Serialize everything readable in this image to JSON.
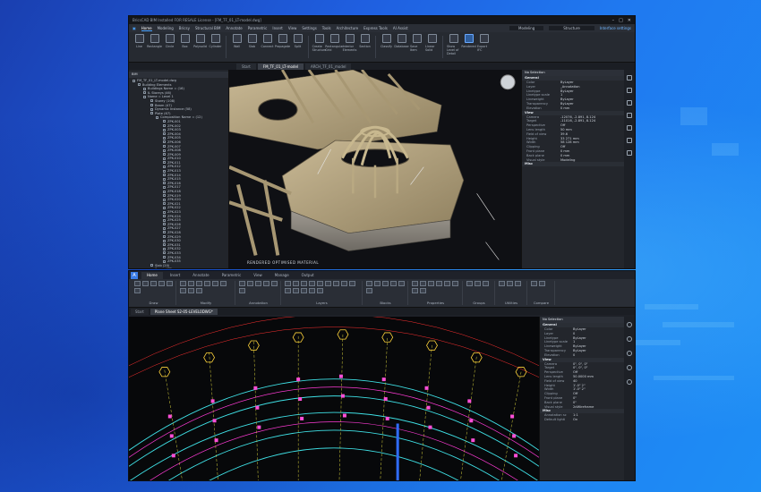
{
  "bricscad": {
    "title": "BricsCAD BIM Installed FOR RESALE License - [FM_TF_01_LT-model.dwg]",
    "menus": [
      {
        "label": "Home",
        "active": true
      },
      {
        "label": "Modeling",
        "active": false
      },
      {
        "label": "Bricsy",
        "active": false
      },
      {
        "label": "Structural BIM",
        "active": false
      },
      {
        "label": "Annotate",
        "active": false
      },
      {
        "label": "Parametric",
        "active": false
      },
      {
        "label": "Insert",
        "active": false
      },
      {
        "label": "View",
        "active": false
      },
      {
        "label": "Settings",
        "active": false
      },
      {
        "label": "Tools",
        "active": false
      },
      {
        "label": "Architecture",
        "active": false
      },
      {
        "label": "Express Tools",
        "active": false
      },
      {
        "label": "AI Assist",
        "active": false
      }
    ],
    "workspace": "Modeling",
    "layer_value": "Structure",
    "interface_settings": "Interface settings",
    "ribbon_buttons": [
      {
        "label": "Line",
        "hl": false
      },
      {
        "label": "Rectangle",
        "hl": false
      },
      {
        "label": "Circle",
        "hl": false
      },
      {
        "label": "Box",
        "hl": false
      },
      {
        "label": "Polysolid",
        "hl": false
      },
      {
        "label": "Cylinder",
        "hl": false
      },
      {
        "label": "Wall",
        "hl": false
      },
      {
        "label": "Slab",
        "hl": false
      },
      {
        "label": "Connect",
        "hl": false
      },
      {
        "label": "Propagate",
        "hl": false
      },
      {
        "label": "Split",
        "hl": false
      },
      {
        "label": "Create Structure",
        "hl": false
      },
      {
        "label": "Rectangular Grid",
        "hl": false
      },
      {
        "label": "Interior Elements",
        "hl": false
      },
      {
        "label": "Section",
        "hl": false
      },
      {
        "label": "Classify",
        "hl": false
      },
      {
        "label": "Database",
        "hl": false
      },
      {
        "label": "Save Item",
        "hl": false
      },
      {
        "label": "Linear Solid",
        "hl": false
      },
      {
        "label": "Show Level of Detail",
        "hl": false
      },
      {
        "label": "Rendered",
        "hl": true
      },
      {
        "label": "Export IFC",
        "hl": false
      }
    ],
    "doc_tabs": [
      {
        "label": "Start",
        "active": false
      },
      {
        "label": "FM_TF_01_LT-model",
        "active": true
      },
      {
        "label": "ARCH_TF_01_model",
        "active": false
      }
    ],
    "tree_header": "BIM",
    "tree_items": [
      "FM_TF_01_LT-model.dwg",
      "Building Elements",
      "Buildings Name = (16)",
      "IL Storeys (46)",
      "Name = Level 1",
      "Storey (108)",
      "Beam (47)",
      "Dynamic Instance (58)",
      "Plate (67)",
      "Composition Name = (12)",
      "ZPK-001",
      "ZPK-002",
      "ZPK-003",
      "ZPK-004",
      "ZPK-005",
      "ZPK-006",
      "ZPK-007",
      "ZPK-008",
      "ZPK-009",
      "ZPK-010",
      "ZPK-011",
      "ZPK-012",
      "ZPK-013",
      "ZPK-014",
      "ZPK-015",
      "ZPK-016",
      "ZPK-017",
      "ZPK-018",
      "ZPK-019",
      "ZPK-020",
      "ZPK-021",
      "ZPK-022",
      "ZPK-023",
      "ZPK-024",
      "ZPK-025",
      "ZPK-026",
      "ZPK-027",
      "ZPK-028",
      "ZPK-029",
      "ZPK-030",
      "ZPK-031",
      "ZPK-032",
      "ZPK-033",
      "ZPK-034",
      "ZPK-035",
      "Slab (20)",
      "Space (77)",
      "Wall (18)"
    ],
    "viewport_caption": "RENDERED OPTIMISED MATERIAL",
    "props_header": "No Selection",
    "props_sections": [
      {
        "name": "General",
        "rows": [
          {
            "k": "Color",
            "v": "ByLayer"
          },
          {
            "k": "Layer",
            "v": "_Annotation"
          },
          {
            "k": "Linetype",
            "v": "ByLayer"
          },
          {
            "k": "Linetype scale",
            "v": "1"
          },
          {
            "k": "Lineweight",
            "v": "ByLayer"
          },
          {
            "k": "Transparency",
            "v": "ByLayer"
          },
          {
            "k": "Elevation",
            "v": "0 mm"
          }
        ]
      },
      {
        "name": "View",
        "rows": [
          {
            "k": "Camera",
            "v": "-12076, -2.891, 8.124"
          },
          {
            "k": "Target",
            "v": "-11016, -2.891, 8.124"
          },
          {
            "k": "Perspective",
            "v": "Off"
          },
          {
            "k": "Lens length",
            "v": "50 mm"
          },
          {
            "k": "Field of view",
            "v": "39.6"
          },
          {
            "k": "Height",
            "v": "33 271 mm"
          },
          {
            "k": "Width",
            "v": "58 128 mm"
          },
          {
            "k": "Clipping",
            "v": "Off"
          },
          {
            "k": "Front plane",
            "v": "0 mm"
          },
          {
            "k": "Back plane",
            "v": "0 mm"
          },
          {
            "k": "Visual style",
            "v": "Modeling"
          }
        ]
      },
      {
        "name": "Misc",
        "rows": []
      }
    ]
  },
  "autocad": {
    "logo": "A",
    "tabs": [
      {
        "label": "Home",
        "active": true
      },
      {
        "label": "Insert",
        "active": false
      },
      {
        "label": "Annotate",
        "active": false
      },
      {
        "label": "Parametric",
        "active": false
      },
      {
        "label": "View",
        "active": false
      },
      {
        "label": "Manage",
        "active": false
      },
      {
        "label": "Output",
        "active": false
      }
    ],
    "panels": [
      {
        "label": "Draw",
        "icons": 6
      },
      {
        "label": "Modify",
        "icons": 9
      },
      {
        "label": "Annotation",
        "icons": 6
      },
      {
        "label": "Layers",
        "icons": 14
      },
      {
        "label": "Blocks",
        "icons": 6
      },
      {
        "label": "Properties",
        "icons": 8
      },
      {
        "label": "Groups",
        "icons": 3
      },
      {
        "label": "Utilities",
        "icons": 3
      },
      {
        "label": "Compare",
        "icons": 2
      }
    ],
    "doc_tabs": [
      {
        "label": "Start",
        "active": false
      },
      {
        "label": "Plane Sheet S2-05-LEVEL0DWG*",
        "active": true
      }
    ],
    "props_header": "No Selection",
    "props_sections": [
      {
        "name": "General",
        "rows": [
          {
            "k": "Color",
            "v": "ByLayer"
          },
          {
            "k": "Layer",
            "v": "0"
          },
          {
            "k": "Linetype",
            "v": "ByLayer"
          },
          {
            "k": "Linetype scale",
            "v": "1"
          },
          {
            "k": "Lineweight",
            "v": "ByLayer"
          },
          {
            "k": "Transparency",
            "v": "ByLayer"
          },
          {
            "k": "Elevation",
            "v": "0"
          }
        ]
      },
      {
        "name": "View",
        "rows": [
          {
            "k": "Camera",
            "v": "0\", 0\", 0\""
          },
          {
            "k": "Target",
            "v": "0\", 0\", 0\""
          },
          {
            "k": "Perspective",
            "v": "Off"
          },
          {
            "k": "Lens length",
            "v": "50.0000 mm"
          },
          {
            "k": "Field of view",
            "v": "40"
          },
          {
            "k": "Height",
            "v": "1'-0\" 2\""
          },
          {
            "k": "Width",
            "v": "1'-0\" 2\""
          },
          {
            "k": "Clipping",
            "v": "Off"
          },
          {
            "k": "Front plane",
            "v": "0\""
          },
          {
            "k": "Back plane",
            "v": "0\""
          },
          {
            "k": "Visual style",
            "v": "2dWireframe"
          }
        ]
      },
      {
        "name": "Misc",
        "rows": [
          {
            "k": "Annotation sc",
            "v": "1:1"
          },
          {
            "k": "Default lighti",
            "v": "On"
          }
        ]
      }
    ]
  }
}
